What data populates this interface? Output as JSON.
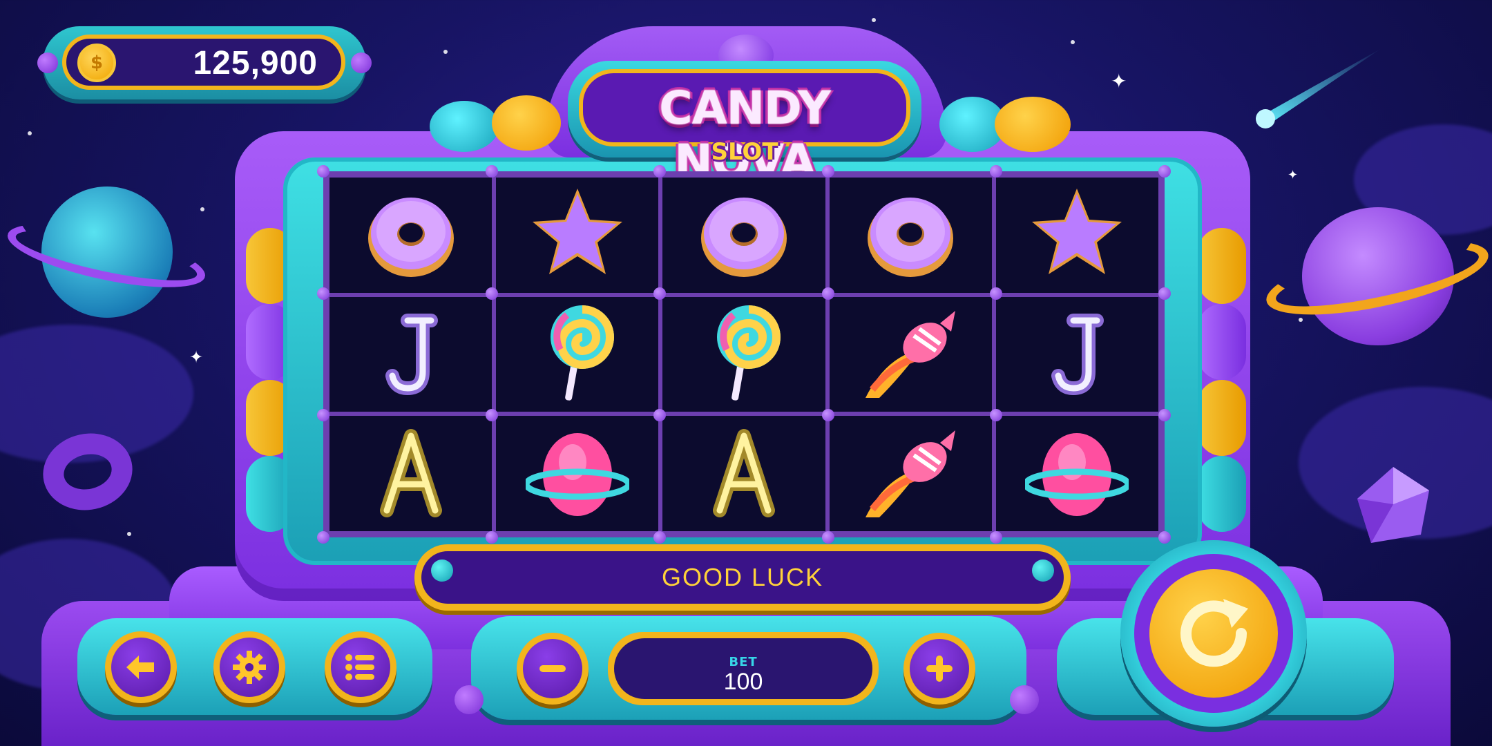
{
  "balance": {
    "value": "125,900",
    "icon": "coin-icon"
  },
  "title": {
    "main": "CANDY NOVA",
    "sub": "SLOT"
  },
  "reels": [
    [
      "donut",
      "star",
      "donut",
      "donut",
      "star"
    ],
    [
      "letter-j",
      "lollipop",
      "lollipop",
      "candy-comet",
      "letter-j"
    ],
    [
      "letter-a",
      "candy-planet",
      "letter-a",
      "candy-comet",
      "candy-planet"
    ]
  ],
  "message": "GOOD LUCK",
  "bet": {
    "label": "BET",
    "value": "100"
  },
  "controls": {
    "left": [
      "back-arrow-icon",
      "gear-icon",
      "menu-list-icon"
    ],
    "bet_buttons": [
      "minus-icon",
      "plus-icon"
    ],
    "spin": "spin-arrow-icon"
  },
  "colors": {
    "background": "#171463",
    "cabinet_purple": "#9b4bf0",
    "teal": "#2fc6cf",
    "gold": "#f2b51c",
    "reel_bg": "#0c0b2e"
  }
}
